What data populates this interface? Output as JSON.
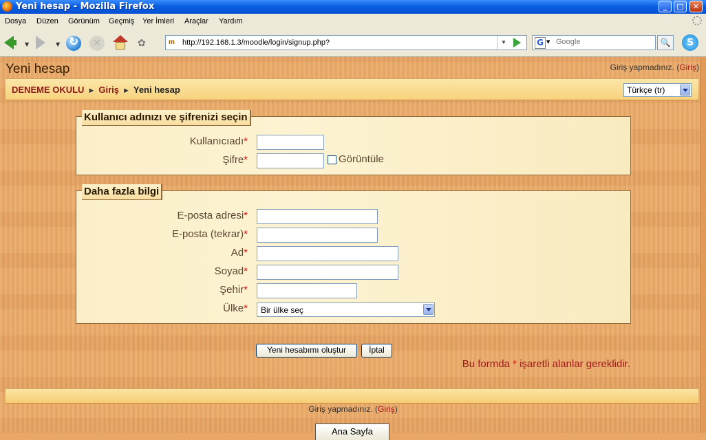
{
  "window": {
    "title": "Yeni hesap - Mozilla Firefox",
    "buttons": {
      "minimize": "_",
      "maximize": "□",
      "close": "✕"
    }
  },
  "menu": [
    "Dosya",
    "Düzen",
    "Görünüm",
    "Geçmiş",
    "Yer İmleri",
    "Araçlar",
    "Yardım"
  ],
  "toolbar": {
    "url": "http://192.168.1.3/moodle/login/signup.php?",
    "search_placeholder": "Google",
    "search_engine": "G",
    "favicon": "m"
  },
  "page": {
    "heading": "Yeni hesap",
    "login_status": "Giriş yapmadınız.",
    "login_link": "Giriş",
    "breadcrumb": [
      {
        "label": "DENEME OKULU"
      },
      {
        "label": "Giriş"
      },
      {
        "label": "Yeni hesap"
      }
    ],
    "breadcrumb_separator": "►",
    "language": "Türkçe (tr)"
  },
  "form": {
    "section1": {
      "legend": "Kullanıcı adınızı ve şifrenizi seçin",
      "username_label": "Kullanıcıadı",
      "password_label": "Şifre",
      "show_password_label": "Görüntüle"
    },
    "section2": {
      "legend": "Daha fazla bilgi",
      "email_label": "E-posta adresi",
      "email2_label": "E-posta (tekrar)",
      "firstname_label": "Ad",
      "lastname_label": "Soyad",
      "city_label": "Şehir",
      "country_label": "Ülke",
      "country_value": "Bir ülke seç"
    },
    "required_mark": "*",
    "submit_label": "Yeni hesabımı oluştur",
    "cancel_label": "İptal",
    "required_note_pre": "Bu formda",
    "required_note_post": "işaretli alanlar gereklidir."
  },
  "footer": {
    "login_status": "Giriş yapmadınız.",
    "login_link": "Giriş",
    "home_button": "Ana Sayfa"
  }
}
